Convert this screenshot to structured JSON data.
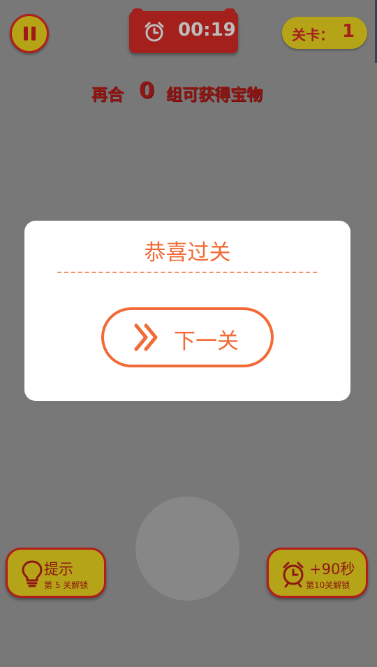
{
  "hud": {
    "timer": "00:19",
    "level_label": "关卡：",
    "level_value": "1"
  },
  "goal": {
    "prefix": "再合",
    "count": "0",
    "suffix": "组可获得宝物"
  },
  "dialog": {
    "title": "恭喜过关",
    "next_button": "下一关"
  },
  "bottom": {
    "hint_label": "提示",
    "hint_unlock": "第 5 关解锁",
    "time_label": "+90秒",
    "time_unlock": "第10关解锁"
  },
  "colors": {
    "accent_orange": "#f26a35",
    "hud_red": "#a3201c",
    "hud_yellow": "#b5a417",
    "overlay_gray": "#787878"
  },
  "icons": [
    "pause-icon",
    "alarm-clock-icon",
    "double-chevron-right-icon",
    "lightbulb-icon"
  ]
}
